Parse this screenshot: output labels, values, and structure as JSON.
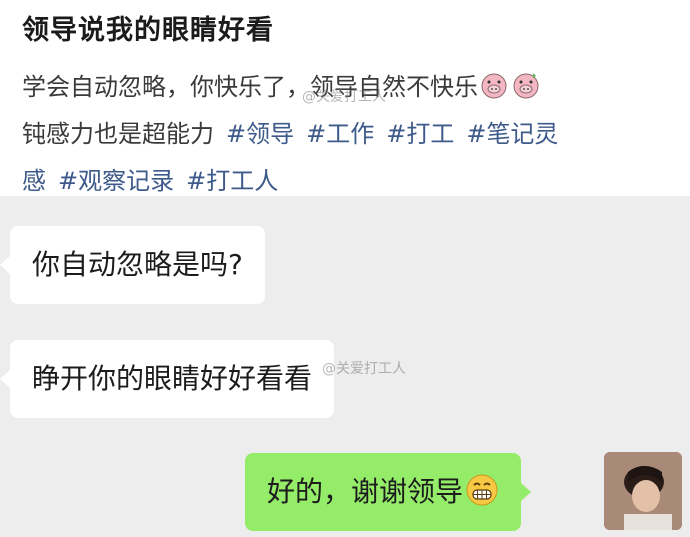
{
  "post": {
    "title": "领导说我的眼睛好看",
    "line1_text": "学会自动忽略，你快乐了，领导自然不快乐",
    "line2_text": "钝感力也是超能力",
    "tags_line2": [
      "#领导",
      "#工作",
      "#打工",
      "#笔记灵"
    ],
    "line3_start": "感",
    "tags_line3": [
      "#观察记录",
      "#打工人"
    ],
    "watermark": "@关爱打工人"
  },
  "chat": {
    "messages": [
      {
        "side": "left",
        "text": "你自动忽略是吗?"
      },
      {
        "side": "left",
        "text": "睁开你的眼睛好好看看"
      },
      {
        "side": "right",
        "text": "好的，谢谢领导"
      }
    ],
    "watermark": "@关爱打工人"
  },
  "colors": {
    "tag": "#3d5a8a",
    "chat_bg": "#ededed",
    "sent_bubble": "#95ec69",
    "received_bubble": "#ffffff"
  },
  "icons": [
    "pig-emoji-icon",
    "grin-emoji-icon",
    "avatar"
  ]
}
